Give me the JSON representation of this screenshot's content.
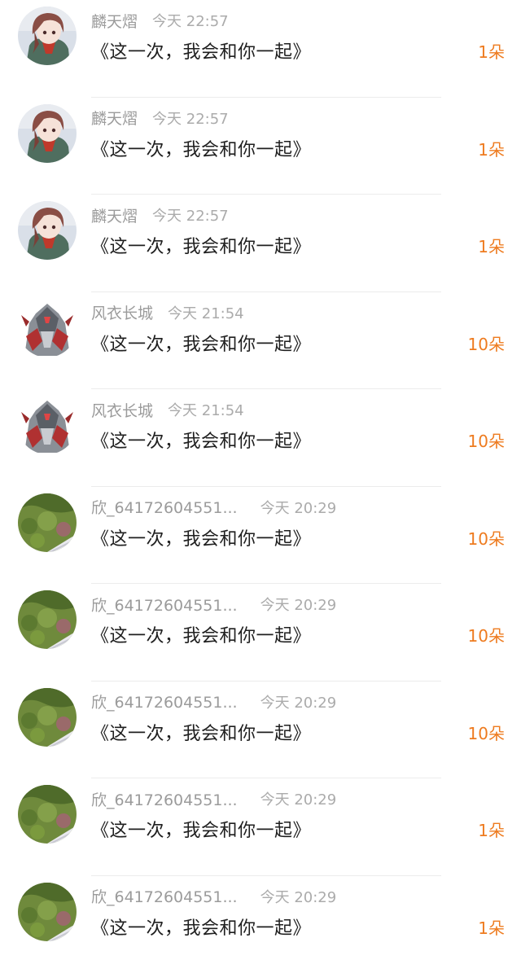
{
  "comments": [
    {
      "avatar": "anime-avatar",
      "username": "麟天熠",
      "time": "今天 22:57",
      "message": "《这一次，我会和你一起》",
      "gift": "1朵"
    },
    {
      "avatar": "anime-avatar",
      "username": "麟天熠",
      "time": "今天 22:57",
      "message": "《这一次，我会和你一起》",
      "gift": "1朵"
    },
    {
      "avatar": "anime-avatar",
      "username": "麟天熠",
      "time": "今天 22:57",
      "message": "《这一次，我会和你一起》",
      "gift": "1朵"
    },
    {
      "avatar": "mecha-avatar",
      "username": "风衣长城",
      "time": "今天 21:54",
      "message": "《这一次，我会和你一起》",
      "gift": "10朵"
    },
    {
      "avatar": "mecha-avatar",
      "username": "风衣长城",
      "time": "今天 21:54",
      "message": "《这一次，我会和你一起》",
      "gift": "10朵"
    },
    {
      "avatar": "plant-avatar",
      "username": "欣_64172604551...",
      "time": "今天 20:29",
      "message": "《这一次，我会和你一起》",
      "gift": "10朵"
    },
    {
      "avatar": "plant-avatar",
      "username": "欣_64172604551...",
      "time": "今天 20:29",
      "message": "《这一次，我会和你一起》",
      "gift": "10朵"
    },
    {
      "avatar": "plant-avatar",
      "username": "欣_64172604551...",
      "time": "今天 20:29",
      "message": "《这一次，我会和你一起》",
      "gift": "10朵"
    },
    {
      "avatar": "plant-avatar",
      "username": "欣_64172604551...",
      "time": "今天 20:29",
      "message": "《这一次，我会和你一起》",
      "gift": "1朵"
    },
    {
      "avatar": "plant-avatar",
      "username": "欣_64172604551...",
      "time": "今天 20:29",
      "message": "《这一次，我会和你一起》",
      "gift": "1朵"
    }
  ],
  "colors": {
    "gift": "#ee7b1f",
    "username": "#9b9b9b",
    "time": "#ababab",
    "message": "#1f1f1f"
  }
}
